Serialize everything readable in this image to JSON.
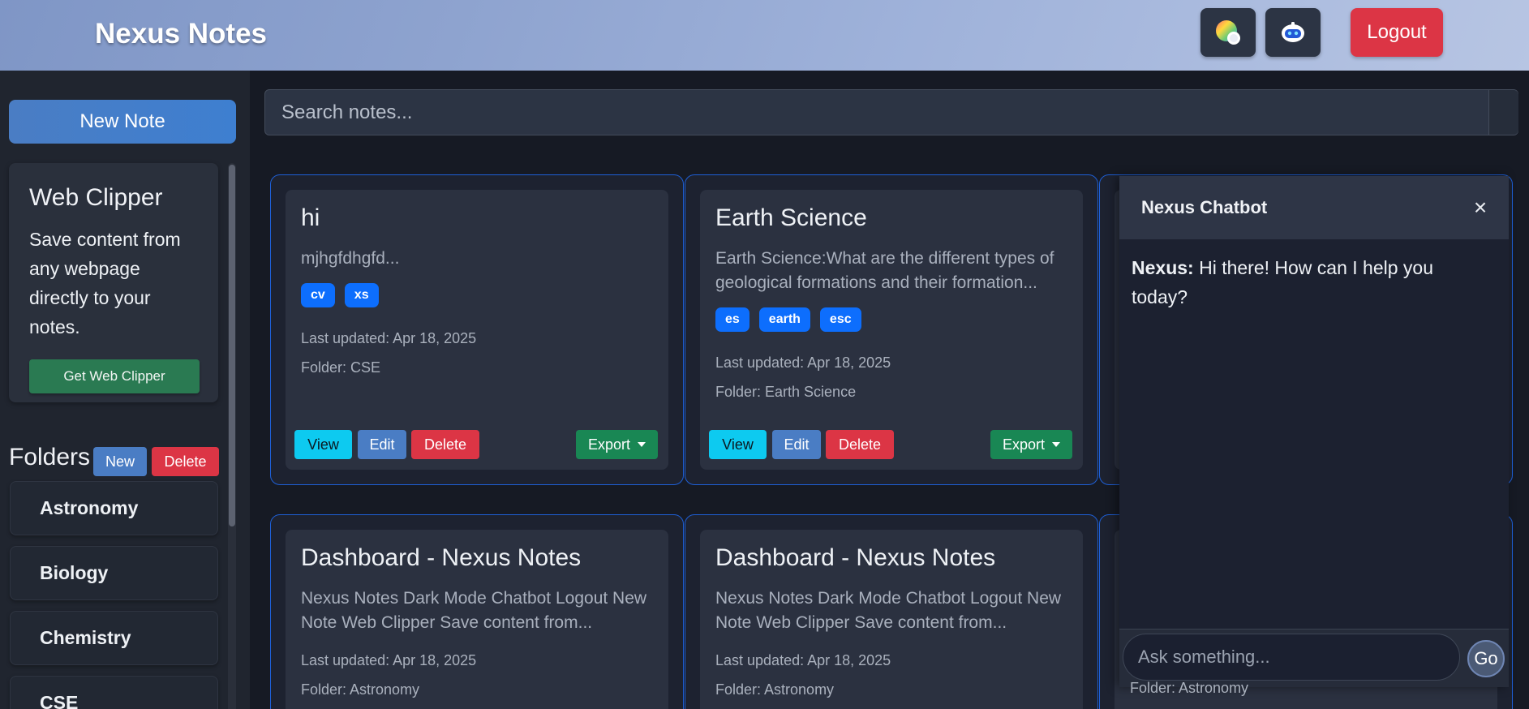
{
  "header": {
    "brand": "Nexus Notes",
    "theme_icon": "palette-icon",
    "chatbot_icon": "robot-icon",
    "logout_label": "Logout"
  },
  "sidebar": {
    "new_note_label": "New Note",
    "clipper": {
      "title": "Web Clipper",
      "description": "Save content from any webpage directly to your notes.",
      "button_label": "Get Web Clipper"
    },
    "folders": {
      "title": "Folders",
      "new_label": "New",
      "delete_label": "Delete",
      "items": [
        "Astronomy",
        "Biology",
        "Chemistry",
        "CSE"
      ]
    }
  },
  "search": {
    "placeholder": "Search notes..."
  },
  "notes": [
    {
      "title": "hi",
      "snippet": "mjhgfdhgfd...",
      "tags": [
        "cv",
        "xs"
      ],
      "updated": "Last updated: Apr 18, 2025",
      "folder": "Folder: CSE"
    },
    {
      "title": "Earth Science",
      "snippet": "Earth Science:What are the different types of geological formations and their formation...",
      "tags": [
        "es",
        "earth",
        "esc"
      ],
      "updated": "Last updated: Apr 18, 2025",
      "folder": "Folder: Earth Science"
    },
    {
      "title": "Dashboard - Nexus Notes",
      "snippet": "Nexus Notes Dark Mode Chatbot Logout New Note Web Clipper Save content from...",
      "tags": [],
      "updated": "Last updated: Apr 18, 2025",
      "folder": "Folder: Astronomy"
    },
    {
      "title": "Dashboard - Nexus Notes",
      "snippet": "Nexus Notes Dark Mode Chatbot Logout New Note Web Clipper Save content from...",
      "tags": [],
      "updated": "Last updated: Apr 18, 2025",
      "folder": "Folder: Astronomy"
    }
  ],
  "partial_folder_text": "Folder: Astronomy",
  "card_actions": {
    "view": "View",
    "edit": "Edit",
    "delete": "Delete",
    "export": "Export"
  },
  "chat": {
    "title": "Nexus Chatbot",
    "close": "×",
    "sender": "Nexus:",
    "message": " Hi there! How can I help you today?",
    "input_placeholder": "Ask something...",
    "send_label": "Go"
  },
  "colors": {
    "accent": "#4a7dc4",
    "danger": "#dc3545",
    "success": "#198754",
    "info": "#0dcaf0",
    "tag": "#0d6efd",
    "card_border": "#1e5fd6"
  }
}
